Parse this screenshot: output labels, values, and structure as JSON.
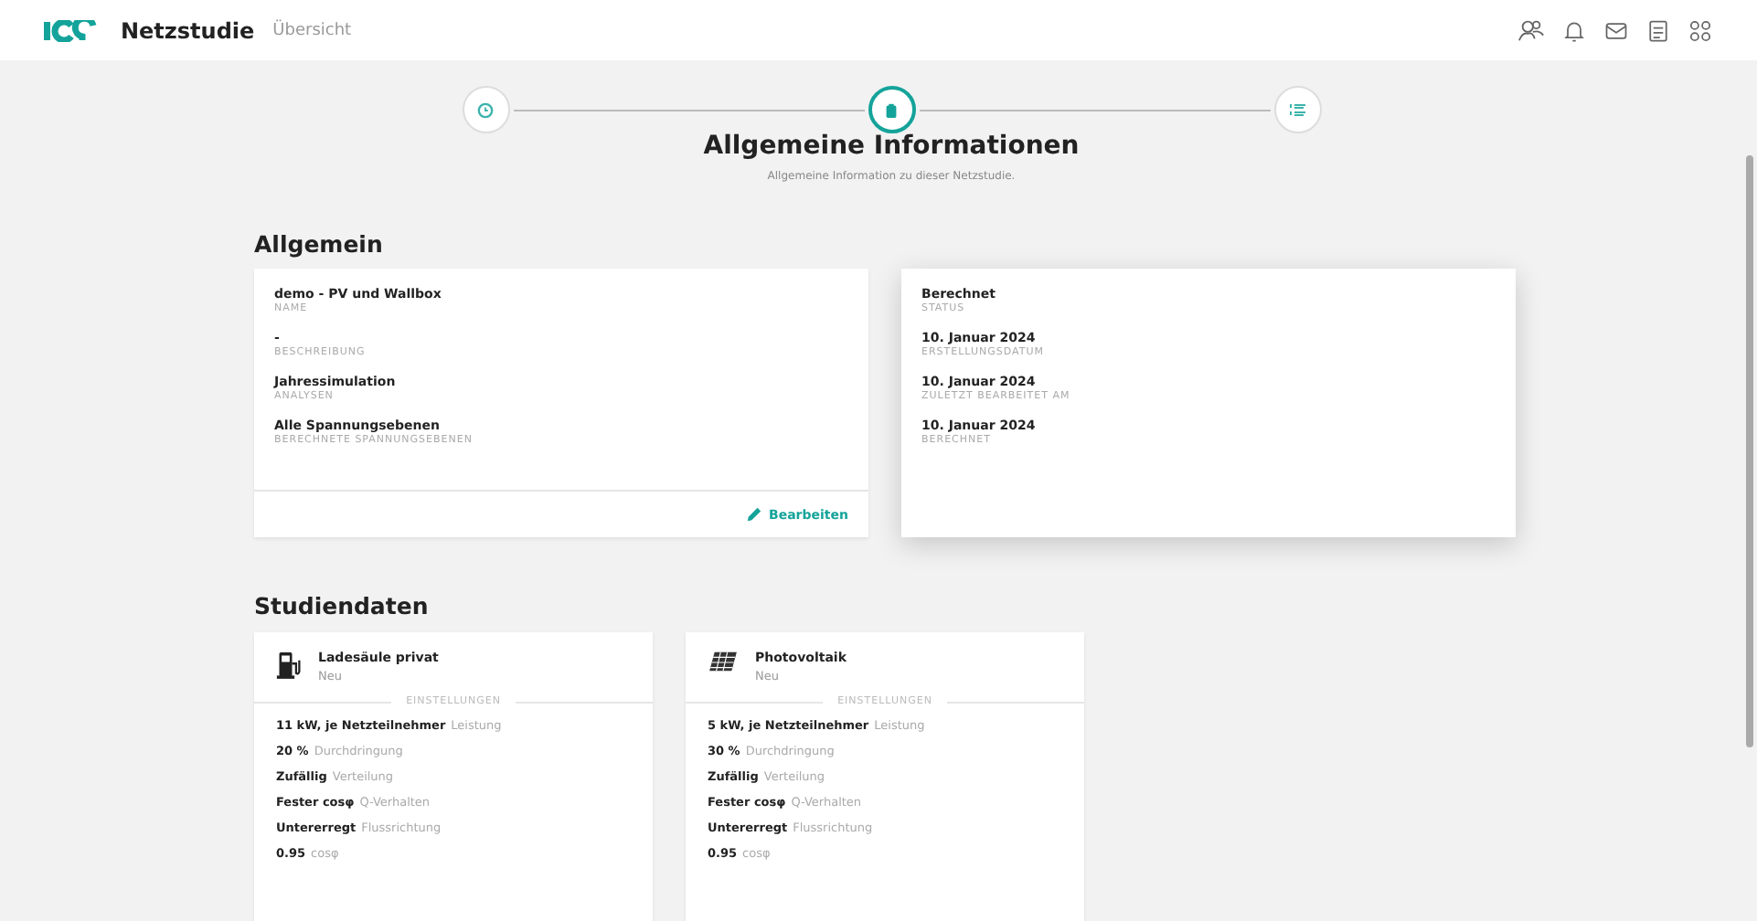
{
  "header": {
    "app_name": "Netzstudie",
    "breadcrumb": "Übersicht"
  },
  "stepper": [
    {
      "kind": "clock",
      "selected": false
    },
    {
      "kind": "clipboard",
      "selected": true
    },
    {
      "kind": "list",
      "selected": false
    }
  ],
  "page_title": "Allgemeine Informationen",
  "page_subtitle": "Allgemeine Information zu dieser Netzstudie.",
  "general": {
    "heading": "Allgemein",
    "left_card": {
      "fields": [
        {
          "value": "demo - PV und Wallbox",
          "label": "NAME"
        },
        {
          "value": "-",
          "label": "BESCHREIBUNG"
        },
        {
          "value": "Jahressimulation",
          "label": "ANALYSEN"
        },
        {
          "value": "Alle Spannungsebenen",
          "label": "BERECHNETE SPANNUNGSEBENEN"
        }
      ],
      "edit_button": "Bearbeiten"
    },
    "right_card": {
      "fields": [
        {
          "value": "Berechnet",
          "label": "STATUS"
        },
        {
          "value": "10. Januar 2024",
          "label": "ERSTELLUNGSDATUM"
        },
        {
          "value": "10. Januar 2024",
          "label": "ZULETZT BEARBEITET AM"
        },
        {
          "value": "10. Januar 2024",
          "label": "BERECHNET"
        }
      ]
    }
  },
  "study_data": {
    "heading": "Studiendaten",
    "cards": [
      {
        "kind": "charger",
        "title": "Ladesäule privat",
        "subtitle": "Neu",
        "divider": "EINSTELLUNGEN",
        "settings": [
          {
            "value": "11 kW, je Netzteilnehmer",
            "label": "Leistung"
          },
          {
            "value": "20 %",
            "label": "Durchdringung"
          },
          {
            "value": "Zufällig",
            "label": "Verteilung"
          },
          {
            "value": "Fester cosφ",
            "label": "Q-Verhalten"
          },
          {
            "value": "Untererregt",
            "label": "Flussrichtung"
          },
          {
            "value": "0.95",
            "label": "cosφ"
          }
        ]
      },
      {
        "kind": "solar",
        "title": "Photovoltaik",
        "subtitle": "Neu",
        "divider": "EINSTELLUNGEN",
        "settings": [
          {
            "value": "5 kW, je Netzteilnehmer",
            "label": "Leistung"
          },
          {
            "value": "30 %",
            "label": "Durchdringung"
          },
          {
            "value": "Zufällig",
            "label": "Verteilung"
          },
          {
            "value": "Fester cosφ",
            "label": "Q-Verhalten"
          },
          {
            "value": "Untererregt",
            "label": "Flussrichtung"
          },
          {
            "value": "0.95",
            "label": "cosφ"
          }
        ]
      }
    ]
  }
}
